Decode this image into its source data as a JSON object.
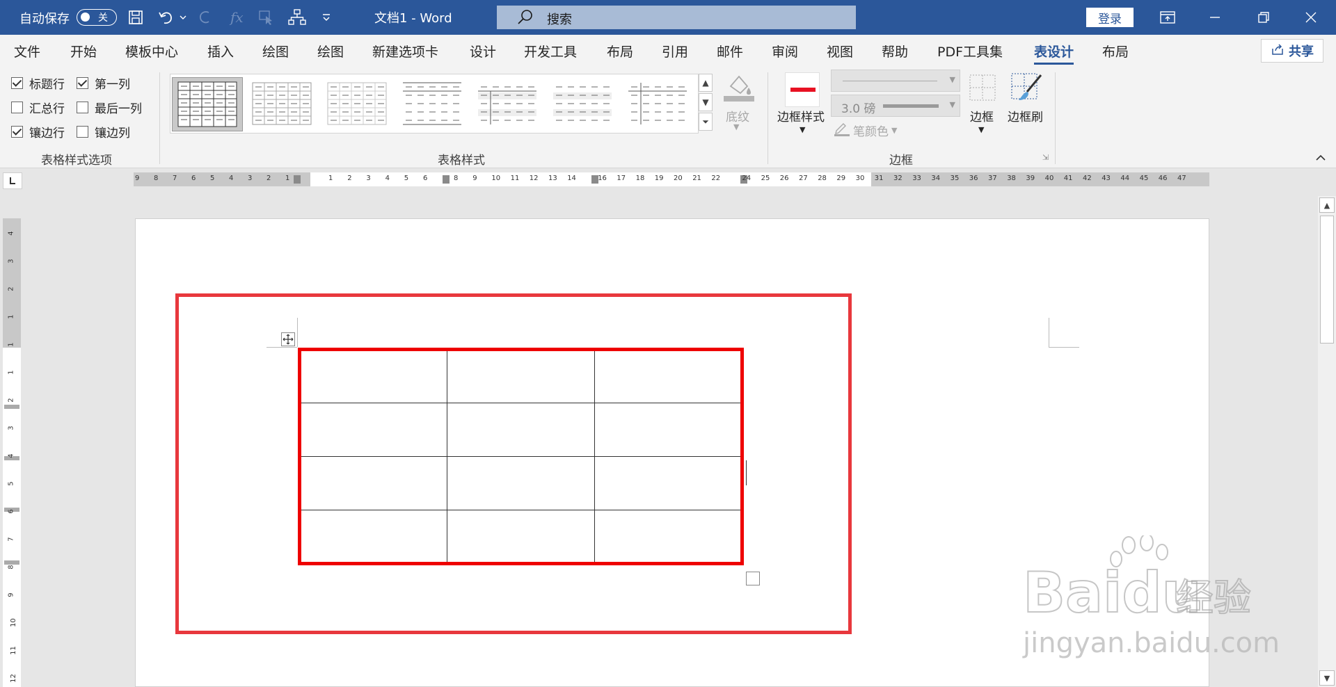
{
  "titlebar": {
    "autosave_label": "自动保存",
    "autosave_state": "关",
    "doc_title": "文档1  -  Word",
    "search_placeholder": "搜索",
    "login_label": "登录",
    "color": "#2b579a"
  },
  "menu": {
    "tabs": [
      "文件",
      "开始",
      "模板中心",
      "插入",
      "绘图",
      "绘图",
      "新建选项卡",
      "设计",
      "开发工具",
      "布局",
      "引用",
      "邮件",
      "审阅",
      "视图",
      "帮助",
      "PDF工具集",
      "表设计",
      "布局"
    ],
    "active_index": 16,
    "share_label": "共享"
  },
  "ribbon": {
    "options": {
      "header_row": "标题行",
      "first_column": "第一列",
      "total_row": "汇总行",
      "last_column": "最后一列",
      "banded_rows": "镶边行",
      "banded_columns": "镶边列",
      "group_label": "表格样式选项",
      "checked": {
        "header_row": true,
        "first_column": true,
        "total_row": false,
        "last_column": false,
        "banded_rows": true,
        "banded_columns": false
      }
    },
    "styles": {
      "group_label": "表格样式",
      "shading_label": "底纹"
    },
    "borders": {
      "border_styles_label": "边框样式",
      "weight_value": "3.0 磅",
      "pen_color_label": "笔颜色",
      "borders_label": "边框",
      "border_painter_label": "边框刷",
      "group_label": "边框",
      "pen_color": "#e81123"
    }
  },
  "ruler": {
    "left_numbers": [
      "9",
      "8",
      "7",
      "6",
      "5",
      "4",
      "3",
      "2",
      "1"
    ],
    "right_numbers": [
      "1",
      "2",
      "3",
      "4",
      "5",
      "6",
      "8",
      "9",
      "10",
      "11",
      "12",
      "13",
      "14",
      "16",
      "17",
      "18",
      "19",
      "20",
      "21",
      "22",
      "24",
      "25",
      "26",
      "27",
      "28",
      "29",
      "30",
      "31",
      "32",
      "33",
      "34",
      "35",
      "36",
      "37",
      "38",
      "39",
      "40",
      "41",
      "42",
      "43",
      "44",
      "45",
      "46",
      "47"
    ],
    "vertical_numbers": [
      "4",
      "3",
      "2",
      "1",
      "1",
      "1",
      "2",
      "3",
      "4",
      "5",
      "6",
      "7",
      "8",
      "9",
      "10",
      "11",
      "12"
    ]
  },
  "document": {
    "table": {
      "rows": 4,
      "cols": 3
    },
    "highlight_color": "#e8383d",
    "table_border_color": "#ee0000"
  },
  "watermark": {
    "brand": "Baidu",
    "cn": "经验",
    "url": "jingyan.baidu.com"
  }
}
